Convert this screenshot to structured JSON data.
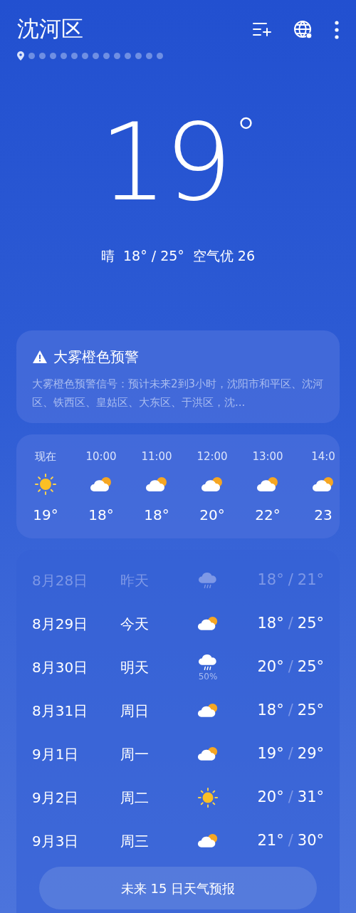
{
  "header": {
    "city": "沈河区",
    "pages": [
      {
        "kind": "location",
        "selected": true
      },
      {
        "kind": "dot",
        "selected": false
      },
      {
        "kind": "dot",
        "selected": false
      },
      {
        "kind": "dot",
        "selected": false
      },
      {
        "kind": "dot",
        "selected": false
      },
      {
        "kind": "dot",
        "selected": false
      },
      {
        "kind": "dot",
        "selected": false
      },
      {
        "kind": "dot",
        "selected": false
      },
      {
        "kind": "dot",
        "selected": false
      },
      {
        "kind": "dot",
        "selected": false
      },
      {
        "kind": "dot",
        "selected": false
      },
      {
        "kind": "dot",
        "selected": false
      },
      {
        "kind": "dot",
        "selected": false
      },
      {
        "kind": "dot",
        "selected": false
      }
    ]
  },
  "current": {
    "temperature": "19",
    "unit": "°",
    "condition": "晴",
    "range": "18° / 25°",
    "aqi": "空气优 26"
  },
  "alert": {
    "title": "大雾橙色预警",
    "text": "大雾橙色预警信号：预计未来2到3小时，沈阳市和平区、沈河区、铁西区、皇姑区、大东区、于洪区，沈..."
  },
  "hourly": [
    {
      "time": "现在",
      "kind": "sunny",
      "temp": "19°"
    },
    {
      "time": "10:00",
      "kind": "partly_cloudy",
      "temp": "18°"
    },
    {
      "time": "11:00",
      "kind": "partly_cloudy",
      "temp": "18°"
    },
    {
      "time": "12:00",
      "kind": "partly_cloudy",
      "temp": "20°"
    },
    {
      "time": "13:00",
      "kind": "partly_cloudy",
      "temp": "22°"
    },
    {
      "time": "14:0",
      "kind": "partly_cloudy",
      "temp": "23"
    }
  ],
  "daily": [
    {
      "date": "8月28日",
      "day": "昨天",
      "kind": "rain",
      "past": true,
      "low": "18°",
      "sep": "/",
      "high": "21°"
    },
    {
      "date": "8月29日",
      "day": "今天",
      "kind": "partly_cloudy",
      "past": false,
      "low": "18°",
      "sep": "/",
      "high": "25°"
    },
    {
      "date": "8月30日",
      "day": "明天",
      "kind": "rain",
      "past": false,
      "precip": "50%",
      "low": "20°",
      "sep": "/",
      "high": "25°"
    },
    {
      "date": "8月31日",
      "day": "周日",
      "kind": "partly_cloudy",
      "past": false,
      "low": "18°",
      "sep": "/",
      "high": "25°"
    },
    {
      "date": "9月1日",
      "day": "周一",
      "kind": "partly_cloudy",
      "past": false,
      "low": "19°",
      "sep": "/",
      "high": "29°"
    },
    {
      "date": "9月2日",
      "day": "周二",
      "kind": "sunny",
      "past": false,
      "low": "20°",
      "sep": "/",
      "high": "31°"
    },
    {
      "date": "9月3日",
      "day": "周三",
      "kind": "partly_cloudy",
      "past": false,
      "low": "21°",
      "sep": "/",
      "high": "30°"
    }
  ],
  "forecast_button": "未来 15 日天气预报"
}
